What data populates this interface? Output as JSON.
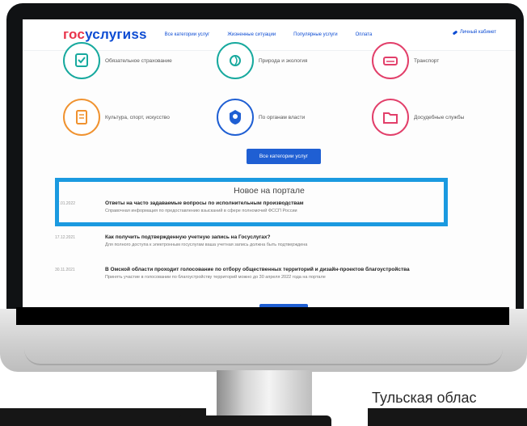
{
  "header": {
    "logo_part1": "гос",
    "logo_part2": "услугиss",
    "nav": [
      "Все категории услуг",
      "Жизненные ситуации",
      "Популярные услуги",
      "Оплата"
    ],
    "login": "Личный кабинет"
  },
  "categories": [
    {
      "label": "Обязательное страхование",
      "icon": "shield-check-icon",
      "color": "#17a99e"
    },
    {
      "label": "Природа и экология",
      "icon": "leaf-icon",
      "color": "#17a99e"
    },
    {
      "label": "Транспорт",
      "icon": "car-icon",
      "color": "#e23f6a"
    },
    {
      "label": "Культура, спорт, искусство",
      "icon": "document-icon",
      "color": "#f0922f"
    },
    {
      "label": "По органам власти",
      "icon": "emblem-icon",
      "color": "#1f5fd3"
    },
    {
      "label": "Досудебные службы",
      "icon": "folder-icon",
      "color": "#e23f6a"
    }
  ],
  "all_categories_button": "Все категории услуг",
  "news": {
    "title": "Новое на портале",
    "items": [
      {
        "date": "17.01.2022",
        "headline": "Ответы на часто задаваемые вопросы по исполнительным производствам",
        "sub": "Справочная информация по предоставлению взысканий в сфере полномочий ФССП России"
      },
      {
        "date": "17.12.2021",
        "headline": "Как получить подтвержденную учетную запись на Госуслугах?",
        "sub": "Для полного доступа к электронным госуслугам ваша учетная запись должна быть подтверждена"
      },
      {
        "date": "30.11.2021",
        "headline": "В Омской области проходит голосование по отбору общественных территорий и дизайн-проектов благоустройства",
        "sub": "Принять участие в голосовании по благоустройству территорий можно до 30 апреля 2022 года на портале"
      }
    ]
  },
  "caption": "Тульская облас",
  "colors": {
    "accent": "#1f5fd3",
    "highlight_frame": "#1b9ae0",
    "logo_red": "#e8344b",
    "logo_blue": "#0d4cd3"
  }
}
